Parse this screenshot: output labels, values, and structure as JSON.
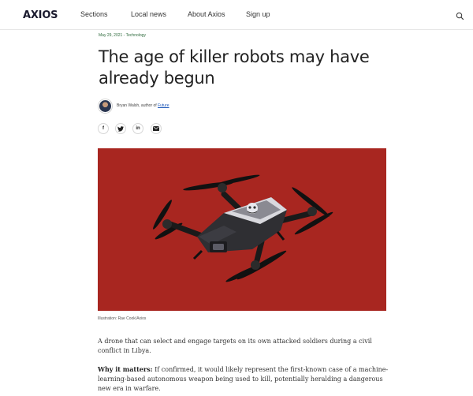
{
  "header": {
    "logo": "AXIOS",
    "nav": {
      "sections": "Sections",
      "local_news": "Local news",
      "about": "About Axios",
      "signup": "Sign up"
    },
    "search_icon": "search-icon"
  },
  "article": {
    "dateline": "May 29, 2021 - Technology",
    "headline": "The age of killer robots may have already begun",
    "byline_prefix": "Bryan Walsh, author of ",
    "byline_link": "Future",
    "share": {
      "facebook": "f",
      "twitter_icon": "twitter-icon",
      "linkedin": "in",
      "email_icon": "email-icon"
    },
    "image_caption": "Illustration: Rae Cook/Axios",
    "paragraph1": "A drone that can select and engage targets on its own attacked soldiers during a civil conflict in Libya.",
    "why_label": "Why it matters:",
    "paragraph2": " If confirmed, it would likely represent the first-known case of a machine-learning-based autonomous weapon being used to kill, potentially heralding a dangerous new era in warfare."
  },
  "colors": {
    "hero_background": "#a82620",
    "dateline": "#2d6a3c",
    "link": "#1a55b8"
  }
}
